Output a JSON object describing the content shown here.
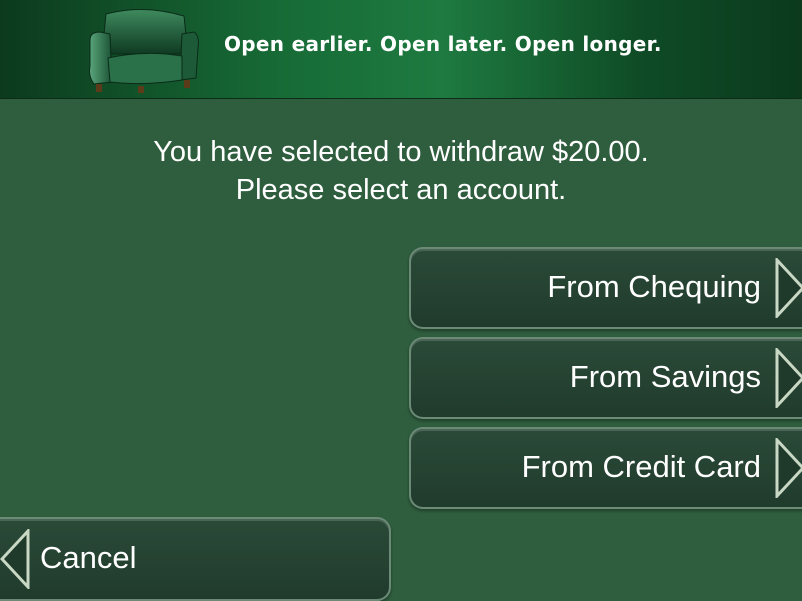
{
  "banner": {
    "slogan": "Open earlier. Open later. Open longer.",
    "image_icon": "armchair-icon"
  },
  "message": {
    "line1": "You have selected to withdraw $20.00.",
    "line2": "Please select an account."
  },
  "accounts": [
    {
      "label": "From Chequing",
      "icon": "chevron-right-icon"
    },
    {
      "label": "From Savings",
      "icon": "chevron-right-icon"
    },
    {
      "label": "From Credit Card",
      "icon": "chevron-right-icon"
    }
  ],
  "cancel": {
    "label": "Cancel",
    "icon": "chevron-left-icon"
  },
  "colors": {
    "background": "#2f5e3e",
    "banner_green": "#1e7a40",
    "button": "#203b2c",
    "text": "#ffffff"
  }
}
